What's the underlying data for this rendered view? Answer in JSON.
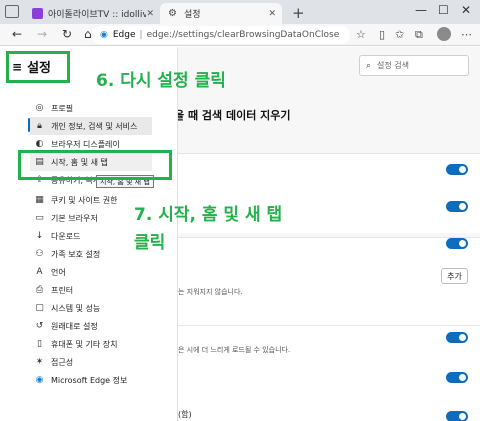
{
  "browser": {
    "tabs": [
      {
        "title": "아이돌라이브TV :: idollive.tv",
        "active": false
      },
      {
        "title": "설정",
        "active": true
      }
    ],
    "new_tab": "+",
    "address": {
      "edge_label": "Edge",
      "separator": "|",
      "url": "edge://settings/clearBrowsingDataOnClose"
    }
  },
  "sidebar": {
    "title": "설정",
    "items": [
      {
        "label": "프로필",
        "icon": "profile-icon"
      },
      {
        "label": "개인 정보, 검색 및 서비스",
        "icon": "lock-icon",
        "active": true
      },
      {
        "label": "브라우저 디스플레이",
        "icon": "display-icon"
      },
      {
        "label": "시작, 홈 및 새 탭",
        "icon": "home-tab-icon",
        "hover": true
      },
      {
        "label": "공유하기, 복사",
        "icon": "share-icon"
      },
      {
        "label": "쿠키 및 사이트 권한",
        "icon": "cookie-icon"
      },
      {
        "label": "기본 브라우저",
        "icon": "browser-icon"
      },
      {
        "label": "다운로드",
        "icon": "download-icon"
      },
      {
        "label": "가족 보호 설정",
        "icon": "family-icon"
      },
      {
        "label": "언어",
        "icon": "language-icon"
      },
      {
        "label": "프린터",
        "icon": "printer-icon"
      },
      {
        "label": "시스템 및 성능",
        "icon": "system-icon"
      },
      {
        "label": "원래대로 설정",
        "icon": "reset-icon"
      },
      {
        "label": "휴대폰 및 기타 장치",
        "icon": "phone-icon"
      },
      {
        "label": "접근성",
        "icon": "accessibility-icon"
      },
      {
        "label": "Microsoft Edge 정보",
        "icon": "edge-logo-icon"
      }
    ],
    "tooltip": "시작, 홈 및 새 탭"
  },
  "main": {
    "search_placeholder": "설정 검색",
    "heading": "을 때 검색 데이터 지우기",
    "text_1": "는 지워지지 않습니다.",
    "add_button": "추가",
    "text_2": "은 시에 더 느리게 로드될 수 있습니다.",
    "text_3": "(함)"
  },
  "annotations": {
    "step6": "6. 다시 설정 클릭",
    "step7_line1": "7. 시작, 홈 및 새 탭",
    "step7_line2": "클릭"
  },
  "colors": {
    "accent": "#0f6cbd",
    "annotation": "#22b14c"
  }
}
